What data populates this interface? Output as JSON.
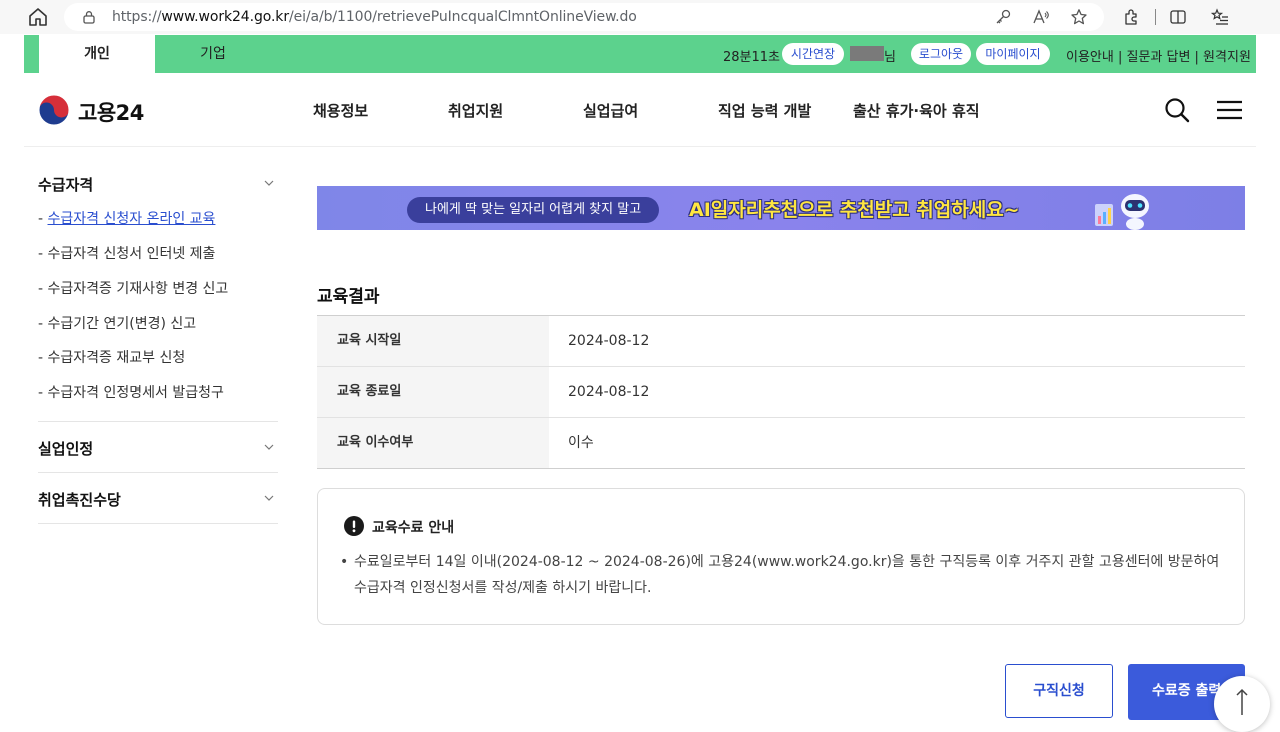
{
  "browser": {
    "url_prefix": "https://",
    "url_domain": "www.work24.go.kr",
    "url_path": "/ei/a/b/1100/retrievePuIncqualClmntOnlineView.do"
  },
  "topbar": {
    "tab_personal": "개인",
    "tab_company": "기업",
    "timer": "28분11초",
    "extend_label": "시간연장",
    "user_suffix": "님",
    "logout_label": "로그아웃",
    "mypage_label": "마이페이지",
    "util_links": "이용안내 | 질문과 답변 | 원격지원",
    "colors": {
      "bar": "#5cd28d",
      "link": "#2a4ecf"
    }
  },
  "header": {
    "logo_text": "고용24",
    "nav": [
      "채용정보",
      "취업지원",
      "실업급여",
      "직업 능력 개발",
      "출산 휴가·육아 휴직"
    ]
  },
  "sidebar": {
    "sections": [
      {
        "title": "수급자격",
        "items": [
          "수급자격 신청자 온라인 교육",
          "수급자격 신청서 인터넷 제출",
          "수급자격증 기재사항 변경 신고",
          "수급기간 연기(변경) 신고",
          "수급자격증 재교부 신청",
          "수급자격 인정명세서 발급청구"
        ]
      },
      {
        "title": "실업인정"
      },
      {
        "title": "취업촉진수당"
      }
    ]
  },
  "banner": {
    "pill_text": "나에게 딱 맞는 일자리 어렵게 찾지 말고",
    "main_text": "AI일자리추천으로 추천받고 취업하세요~"
  },
  "result": {
    "title": "교육결과",
    "rows": [
      {
        "label": "교육 시작일",
        "value": "2024-08-12"
      },
      {
        "label": "교육 종료일",
        "value": "2024-08-12"
      },
      {
        "label": "교육 이수여부",
        "value": "이수"
      }
    ]
  },
  "notice": {
    "title": "교육수료 안내",
    "body": "수료일로부터 14일 이내(2024-08-12 ~ 2024-08-26)에 고용24(www.work24.go.kr)을 통한 구직등록 이후 거주지 관할 고용센터에 방문하여 수급자격 인정신청서를 작성/제출 하시기 바랍니다."
  },
  "buttons": {
    "job_apply": "구직신청",
    "cert_print": "수료증 출력"
  }
}
